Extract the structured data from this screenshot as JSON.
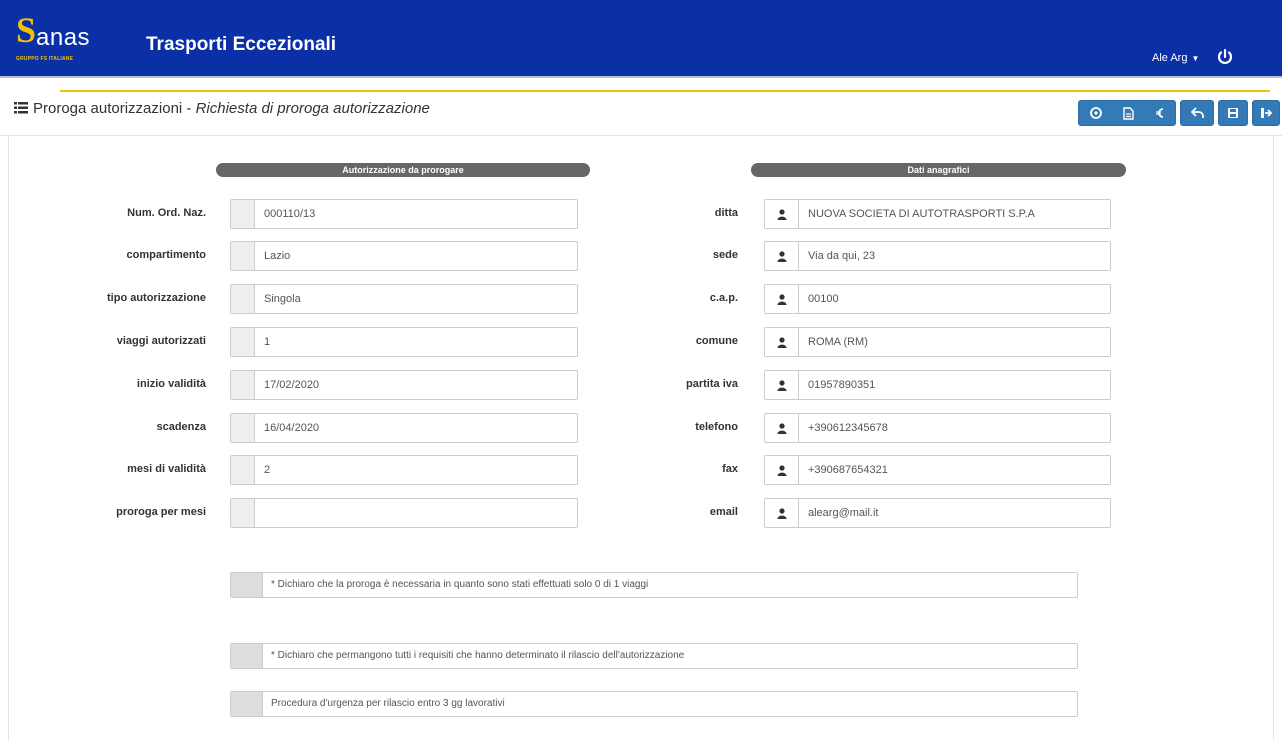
{
  "header": {
    "logo_word": "anas",
    "logo_subtitle": "GRUPPO FS ITALIANE",
    "app_title": "Trasporti Eccezionali",
    "user_name": "Ale Arg"
  },
  "page": {
    "title_main": "Proroga autorizzazioni",
    "title_sep": " - ",
    "title_sub": "Richiesta di proroga autorizzazione"
  },
  "toolbar": {
    "buttons": [
      "info",
      "document",
      "back-arrow",
      "undo",
      "save",
      "exit"
    ]
  },
  "sections": {
    "left_title": "Autorizzazione da prorogare",
    "right_title": "Dati anagrafici"
  },
  "left_fields": [
    {
      "label": "Num. Ord. Naz.",
      "value": "000110/13"
    },
    {
      "label": "compartimento",
      "value": "Lazio"
    },
    {
      "label": "tipo autorizzazione",
      "value": "Singola"
    },
    {
      "label": "viaggi autorizzati",
      "value": "1"
    },
    {
      "label": "inizio validità",
      "value": "17/02/2020"
    },
    {
      "label": "scadenza",
      "value": "16/04/2020"
    },
    {
      "label": "mesi di validità",
      "value": "2"
    },
    {
      "label": "proroga per mesi",
      "value": ""
    }
  ],
  "right_fields": [
    {
      "label": "ditta",
      "value": "NUOVA SOCIETA DI AUTOTRASPORTI S.P.A"
    },
    {
      "label": "sede",
      "value": "Via da qui, 23"
    },
    {
      "label": "c.a.p.",
      "value": "00100"
    },
    {
      "label": "comune",
      "value": "ROMA (RM)"
    },
    {
      "label": "partita iva",
      "value": "01957890351"
    },
    {
      "label": "telefono",
      "value": "+390612345678"
    },
    {
      "label": "fax",
      "value": "+390687654321"
    },
    {
      "label": "email",
      "value": "alearg@mail.it"
    }
  ],
  "declarations": [
    {
      "text": "* Dichiaro che la proroga è necessaria in quanto sono stati effettuati solo 0 di 1 viaggi",
      "checked": false
    },
    {
      "text": "* Dichiaro che permangono tutti i requisiti che hanno determinato il rilascio dell'autorizzazione",
      "checked": false
    },
    {
      "text": "Procedura d'urgenza per rilascio entro 3 gg lavorativi",
      "checked": false
    }
  ],
  "colors": {
    "header_blue": "#0a2fa6",
    "brand_yellow": "#f2c200",
    "button_blue": "#337ab7",
    "pill_gray": "#666666"
  }
}
